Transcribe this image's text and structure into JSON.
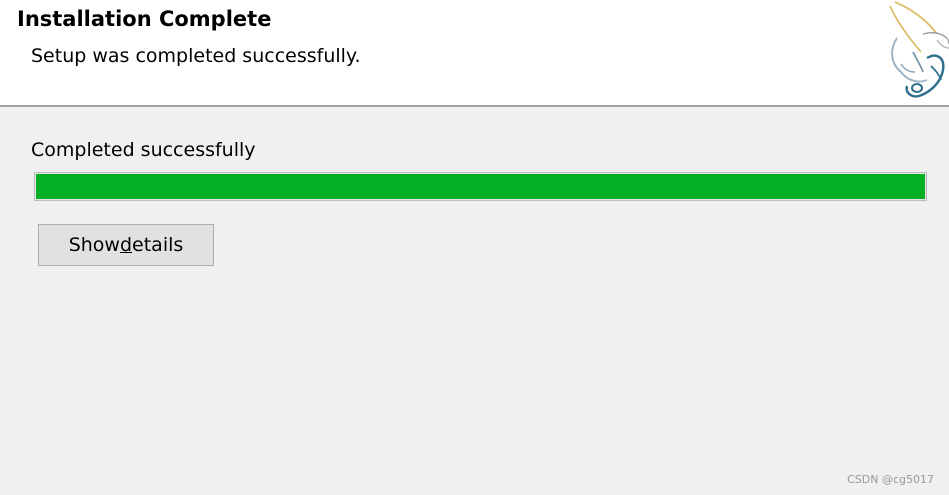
{
  "header": {
    "title": "Installation Complete",
    "subtitle": "Setup was completed successfully.",
    "logo_icon": "installer-wizard-logo"
  },
  "main": {
    "status_text": "Completed successfully",
    "progress_percent": 100,
    "progress_color": "#06b025",
    "details_button": {
      "label_before": "Show ",
      "label_accel": "d",
      "label_after": "etails"
    }
  },
  "watermark": "CSDN @cg5017"
}
